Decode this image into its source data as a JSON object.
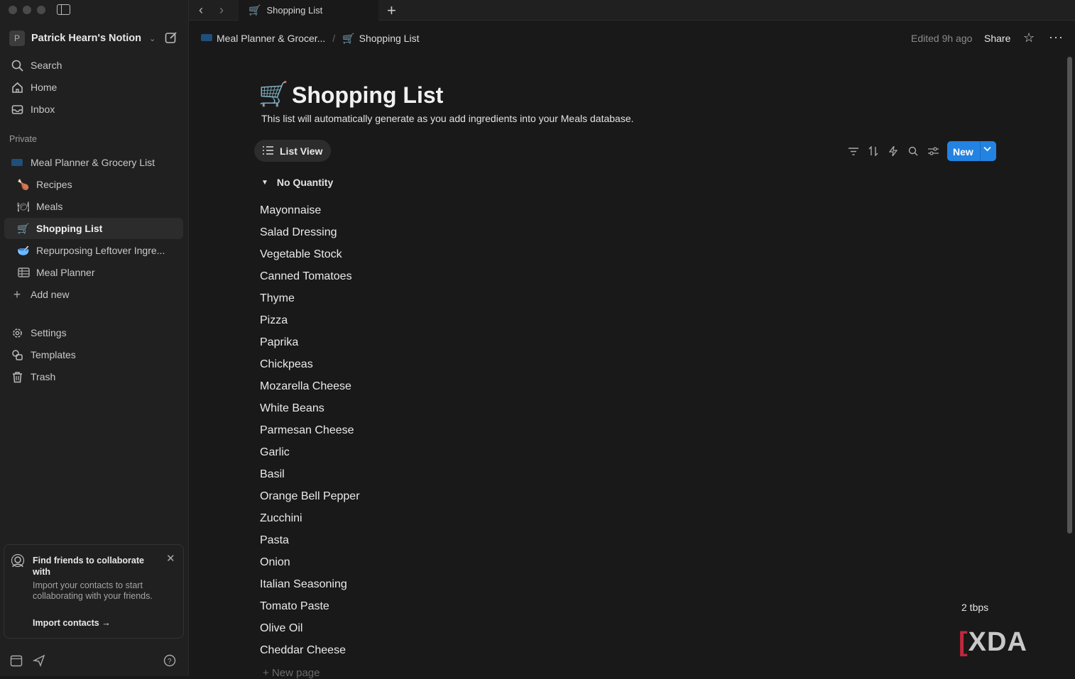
{
  "sidebar": {
    "workspace": {
      "initial": "P",
      "name": "Patrick Hearn's Notion"
    },
    "top_items": [
      {
        "label": "Search"
      },
      {
        "label": "Home"
      },
      {
        "label": "Inbox"
      }
    ],
    "section_label": "Private",
    "pages": [
      {
        "label": "Meal Planner & Grocery List",
        "icon": "book-icon"
      },
      {
        "label": "Recipes",
        "icon": "poultry-leg-icon"
      },
      {
        "label": "Meals",
        "icon": "plate-icon"
      },
      {
        "label": "Shopping List",
        "icon": "shopping-cart-icon",
        "active": true
      },
      {
        "label": "Repurposing Leftover Ingre...",
        "icon": "bowl-icon"
      },
      {
        "label": "Meal Planner",
        "icon": "table-icon"
      }
    ],
    "add_new": "Add new",
    "bottom_items": [
      {
        "label": "Settings"
      },
      {
        "label": "Templates"
      },
      {
        "label": "Trash"
      }
    ],
    "promo": {
      "title": "Find friends to collaborate with",
      "body": "Import your contacts to start collaborating with your friends.",
      "link": "Import contacts"
    }
  },
  "tabbar": {
    "tab_label": "Shopping List"
  },
  "breadcrumb": {
    "parent": "Meal Planner & Grocer...",
    "current": "Shopping List"
  },
  "header": {
    "edited": "Edited 9h ago",
    "share": "Share"
  },
  "page": {
    "title": "Shopping List",
    "description": "This list will automatically generate as you add ingredients into your Meals database.",
    "view_label": "List View",
    "new_button": "New",
    "group_label": "No Quantity",
    "items": [
      "Mayonnaise",
      "Salad Dressing",
      "Vegetable Stock",
      "Canned Tomatoes",
      "Thyme",
      "Pizza",
      "Paprika",
      "Chickpeas",
      "Mozarella Cheese",
      "White Beans",
      "Parmesan Cheese",
      "Garlic",
      "Basil",
      "Orange Bell Pepper",
      "Zucchini",
      "Pasta",
      "Onion",
      "Italian Seasoning",
      "Tomato Paste",
      "Olive Oil",
      "Cheddar Cheese"
    ],
    "quantity_value": "2 tbps",
    "new_page": "New page"
  },
  "watermark": "XDA",
  "colors": {
    "accent": "#2383e2",
    "background": "#191919",
    "sidebar": "#202020"
  }
}
